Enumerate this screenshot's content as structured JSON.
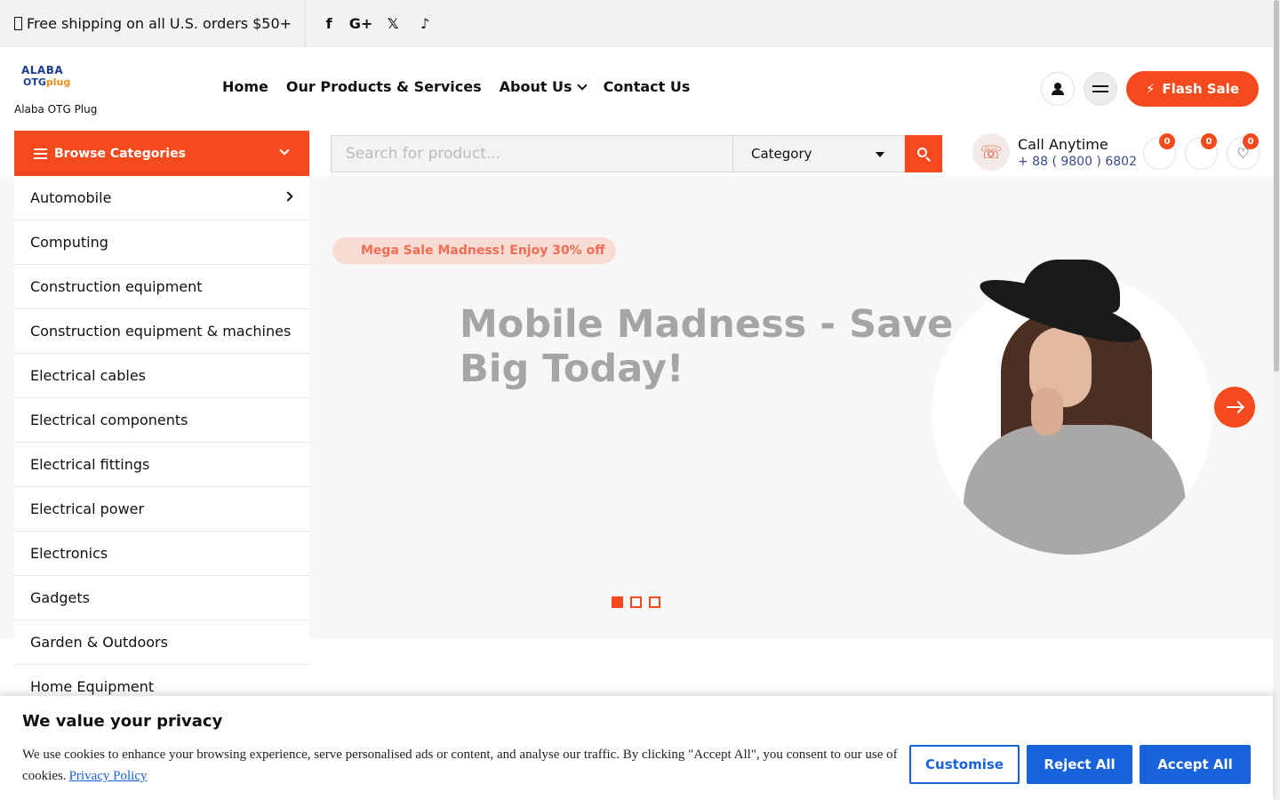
{
  "topbar": {
    "shipping_text": "Free shipping on all U.S. orders $50+",
    "socials": [
      {
        "icon": "facebook-icon",
        "glyph": "f"
      },
      {
        "icon": "google-plus-icon",
        "glyph": "G+"
      },
      {
        "icon": "x-twitter-icon",
        "glyph": "𝕏"
      },
      {
        "icon": "tiktok-icon",
        "glyph": "♪"
      }
    ]
  },
  "header": {
    "logo_text": "Alaba OTG Plug",
    "logo_mark_line1": "ALABA",
    "logo_mark_line2_a": "OTG",
    "logo_mark_line2_b": "plug",
    "nav": [
      "Home",
      "Our Products & Services",
      "About Us",
      "Contact Us"
    ],
    "flash_sale_label": "Flash Sale"
  },
  "browse": {
    "label": "Browse Categories",
    "items": [
      "Automobile",
      "Computing",
      "Construction equipment",
      "Construction equipment & machines",
      "Electrical cables",
      "Electrical components",
      "Electrical fittings",
      "Electrical power",
      "Electronics",
      "Gadgets",
      "Garden & Outdoors",
      "Home Equipment"
    ]
  },
  "search": {
    "placeholder": "Search for product...",
    "category_label": "Category"
  },
  "call": {
    "title": "Call Anytime",
    "number": "+ 88 ( 9800 ) 6802"
  },
  "mini_icons": [
    {
      "icon": "compare-icon",
      "count": "0"
    },
    {
      "icon": "cart-icon",
      "count": "0"
    },
    {
      "icon": "wishlist-heart-icon",
      "count": "0"
    }
  ],
  "hero": {
    "promo": "Mega Sale Madness! Enjoy 30% off",
    "title": "Mobile Madness - Save Big Today!",
    "active_slide": 1,
    "slide_count": 3
  },
  "cookie": {
    "title": "We value your privacy",
    "text": "We use cookies to enhance your browsing experience, serve personalised ads or content, and analyse our traffic. By clicking \"Accept All\", you consent to our use of cookies.",
    "policy_link": "Privacy Policy",
    "customise": "Customise",
    "reject": "Reject All",
    "accept": "Accept All"
  },
  "colors": {
    "accent": "#f44a1e",
    "cookie_blue": "#1863dc"
  }
}
